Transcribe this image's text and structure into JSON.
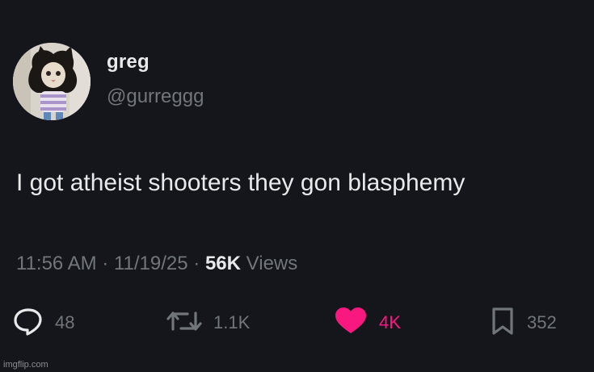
{
  "user": {
    "display_name": "greg",
    "handle": "@gurreggg",
    "avatar_icon": "cat-avatar-icon"
  },
  "tweet": {
    "text": "I got atheist shooters they gon blasphemy",
    "time": "11:56 AM",
    "date": "11/19/25",
    "separator": "·",
    "views_count": "56K",
    "views_label": "Views"
  },
  "actions": {
    "reply": {
      "icon": "reply-icon",
      "count": "48"
    },
    "retweet": {
      "icon": "retweet-icon",
      "count": "1.1K"
    },
    "like": {
      "icon": "heart-icon",
      "count": "4K",
      "color": "#f91880"
    },
    "bookmark": {
      "icon": "bookmark-icon",
      "count": "352"
    }
  },
  "watermark": "imgflip.com",
  "colors": {
    "background": "#15161b",
    "text": "#e7e9ea",
    "muted": "#71767b",
    "like": "#f91880"
  }
}
